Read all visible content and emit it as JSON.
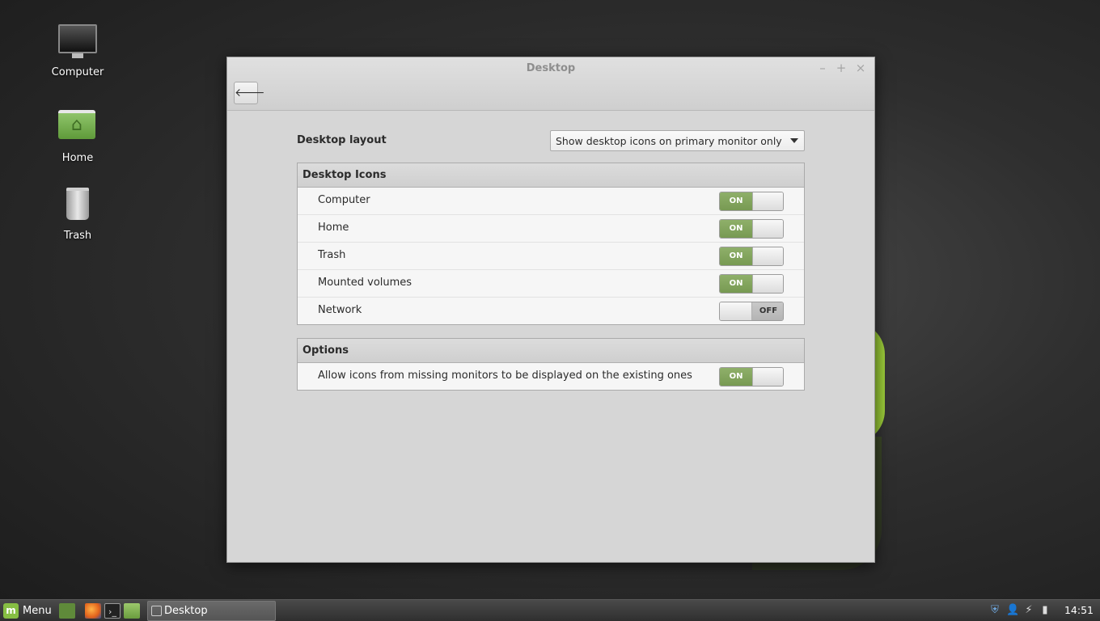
{
  "desktop_icons": [
    {
      "label": "Computer",
      "icon": "computer-icon"
    },
    {
      "label": "Home",
      "icon": "home-folder-icon"
    },
    {
      "label": "Trash",
      "icon": "trash-icon"
    }
  ],
  "window": {
    "title": "Desktop",
    "controls": {
      "minimize": "–",
      "maximize": "+",
      "close": "×"
    },
    "back_glyph": "🡐",
    "layout": {
      "label": "Desktop layout",
      "selected": "Show desktop icons on primary monitor only"
    },
    "sections": [
      {
        "title": "Desktop Icons",
        "rows": [
          {
            "label": "Computer",
            "state": "ON"
          },
          {
            "label": "Home",
            "state": "ON"
          },
          {
            "label": "Trash",
            "state": "ON"
          },
          {
            "label": "Mounted volumes",
            "state": "ON"
          },
          {
            "label": "Network",
            "state": "OFF"
          }
        ]
      },
      {
        "title": "Options",
        "rows": [
          {
            "label": "Allow icons from missing monitors to be displayed on the existing ones",
            "state": "ON"
          }
        ]
      }
    ]
  },
  "taskbar": {
    "menu_label": "Menu",
    "launchers": [
      "show-desktop-icon",
      "firefox-icon",
      "terminal-icon",
      "files-icon"
    ],
    "task_window_label": "Desktop",
    "tray": [
      "shield-icon",
      "user-icon",
      "network-icon",
      "battery-icon"
    ],
    "clock": "14:51"
  },
  "colors": {
    "switch_on": "#86a860",
    "accent_mint": "#86be43"
  }
}
